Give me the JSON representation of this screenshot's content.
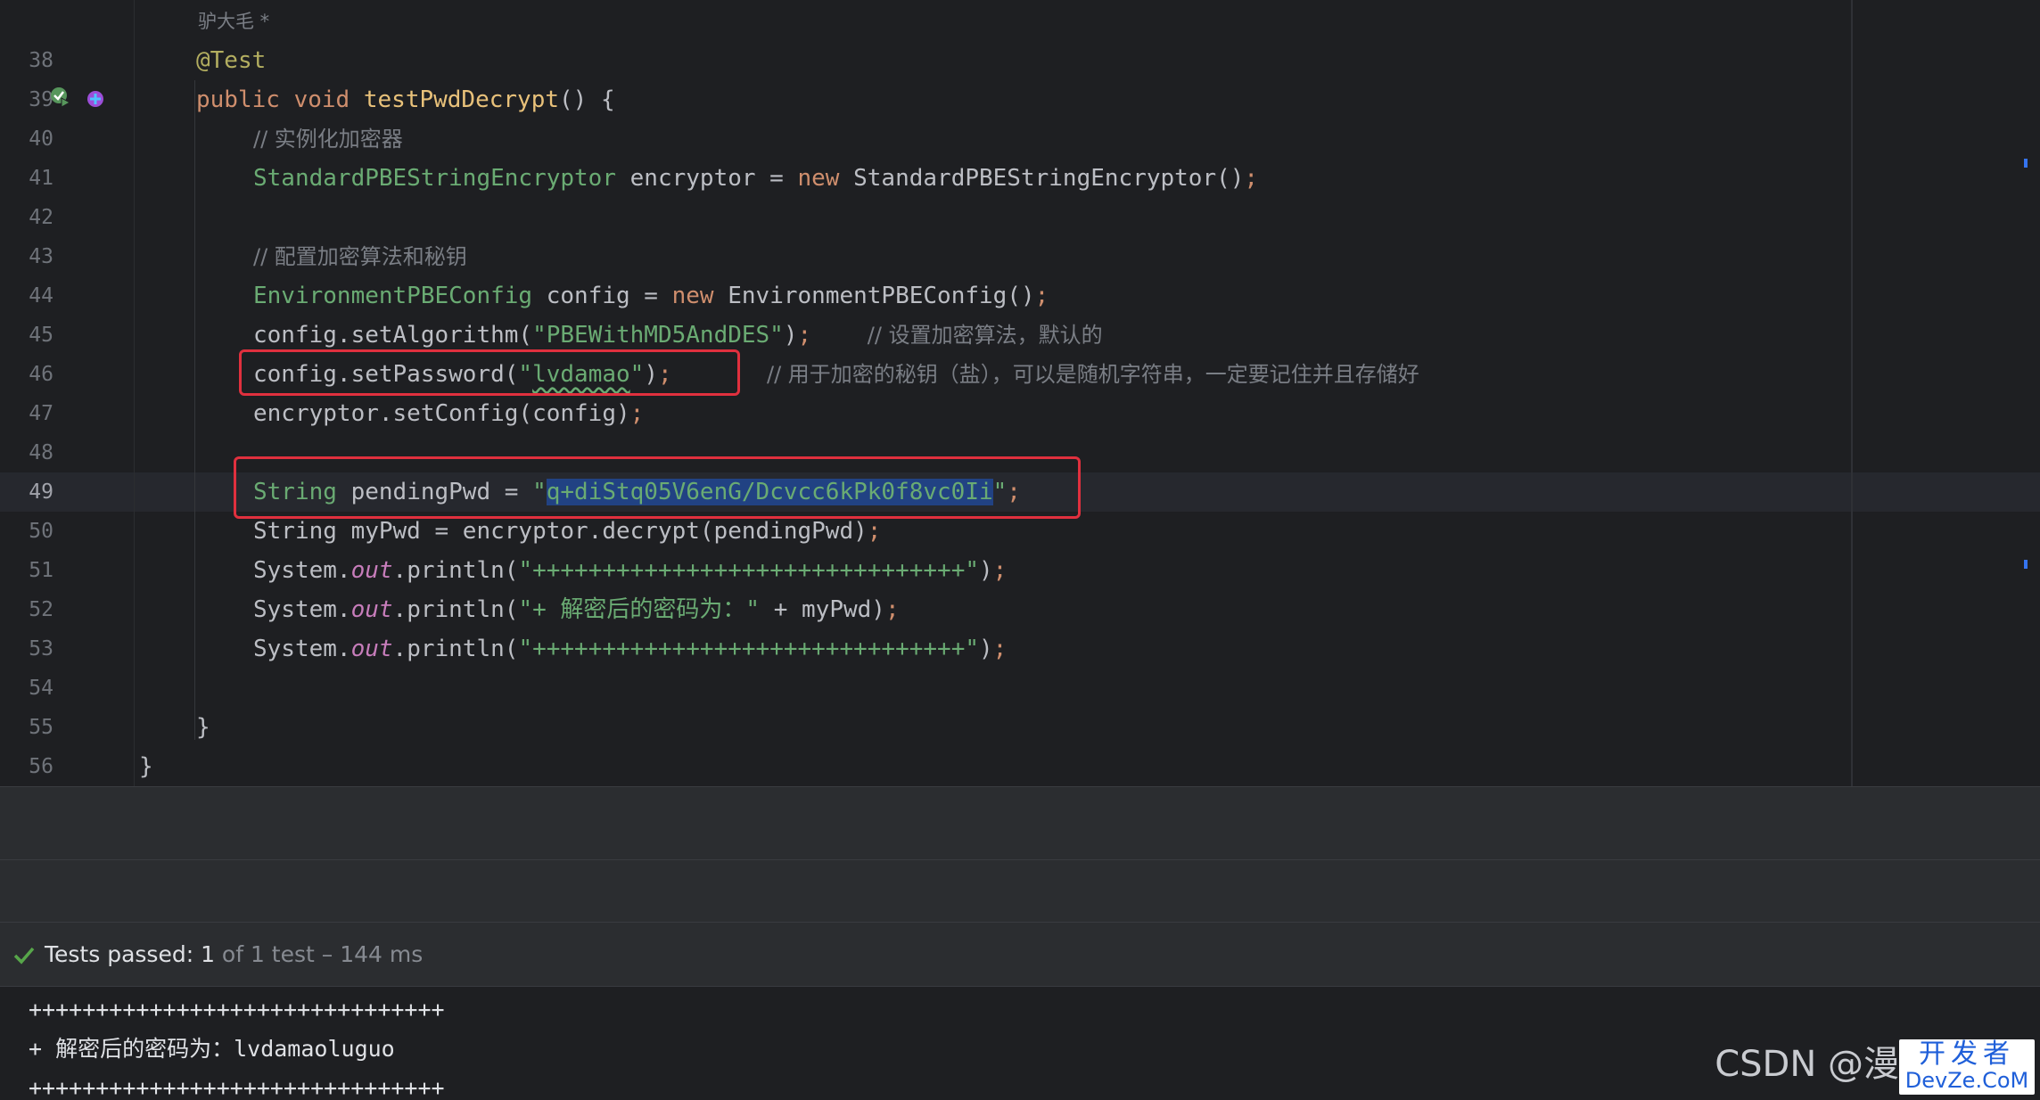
{
  "editor": {
    "author_hint": "驴大毛 *",
    "line_numbers": [
      "38",
      "39",
      "40",
      "41",
      "42",
      "43",
      "44",
      "45",
      "46",
      "47",
      "48",
      "49",
      "50",
      "51",
      "52",
      "53",
      "54",
      "55",
      "56"
    ],
    "current_line": "49",
    "code": {
      "l38_annotation": "@Test",
      "l39_public": "public",
      "l39_void": "void",
      "l39_method": "testPwdDecrypt",
      "l39_rest": "() {",
      "l40_comment": "// 实例化加密器",
      "l41_type": "StandardPBEStringEncryptor",
      "l41_var": " encryptor = ",
      "l41_new": "new",
      "l41_ctor": " StandardPBEStringEncryptor()",
      "l43_comment": "// 配置加密算法和秘钥",
      "l44_type": "EnvironmentPBEConfig",
      "l44_var": " config = ",
      "l44_new": "new",
      "l44_ctor": " EnvironmentPBEConfig()",
      "l45_call": "config.setAlgorithm(",
      "l45_str": "\"PBEWithMD5AndDES\"",
      "l45_close": ")",
      "l45_comment": "// 设置加密算法，默认的",
      "l46_call": "config.setPassword(",
      "l46_str_open": "\"",
      "l46_str_val": "lvdamao",
      "l46_str_close": "\"",
      "l46_close": ")",
      "l46_comment": "// 用于加密的秘钥（盐），可以是随机字符串，一定要记住并且存储好",
      "l47_call": "encryptor.setConfig(config)",
      "l49_type": "String",
      "l49_var": " pendingPwd = ",
      "l49_str_open": "\"",
      "l49_str_val": "q+diStq05V6enG/Dcvcc6kPk0f8vc0Ii",
      "l49_str_close": "\"",
      "l50_code": "String myPwd = encryptor.decrypt(pendingPwd)",
      "l51_sys": "System.",
      "l51_out": "out",
      "l51_call": ".println(",
      "l51_str": "\"+++++++++++++++++++++++++++++++\"",
      "l51_close": ")",
      "l52_sys": "System.",
      "l52_out": "out",
      "l52_call": ".println(",
      "l52_str": "\"+ 解密后的密码为：\"",
      "l52_rest": " + myPwd)",
      "l53_sys": "System.",
      "l53_out": "out",
      "l53_call": ".println(",
      "l53_str": "\"+++++++++++++++++++++++++++++++\"",
      "l53_close": ")",
      "l55_brace": "}",
      "l56_brace": "}",
      "semicolon": ";"
    }
  },
  "tests": {
    "status_prefix": "Tests passed: ",
    "status_count": "1",
    "status_suffix": " of 1 test – 144 ms"
  },
  "console": {
    "lines": [
      "+++++++++++++++++++++++++++++++",
      "+ 解密后的密码为：lvdamaoluguo",
      "+++++++++++++++++++++++++++++++"
    ]
  },
  "watermark": {
    "csdn": "CSDN @漫",
    "devze_top": "开发者",
    "devze_bottom": "DevZe.CoM"
  },
  "colors": {
    "background": "#1e1f22",
    "keyword": "#cf8e6d",
    "string": "#6aab73",
    "selection": "#214283",
    "highlight_box": "#e0303e"
  }
}
